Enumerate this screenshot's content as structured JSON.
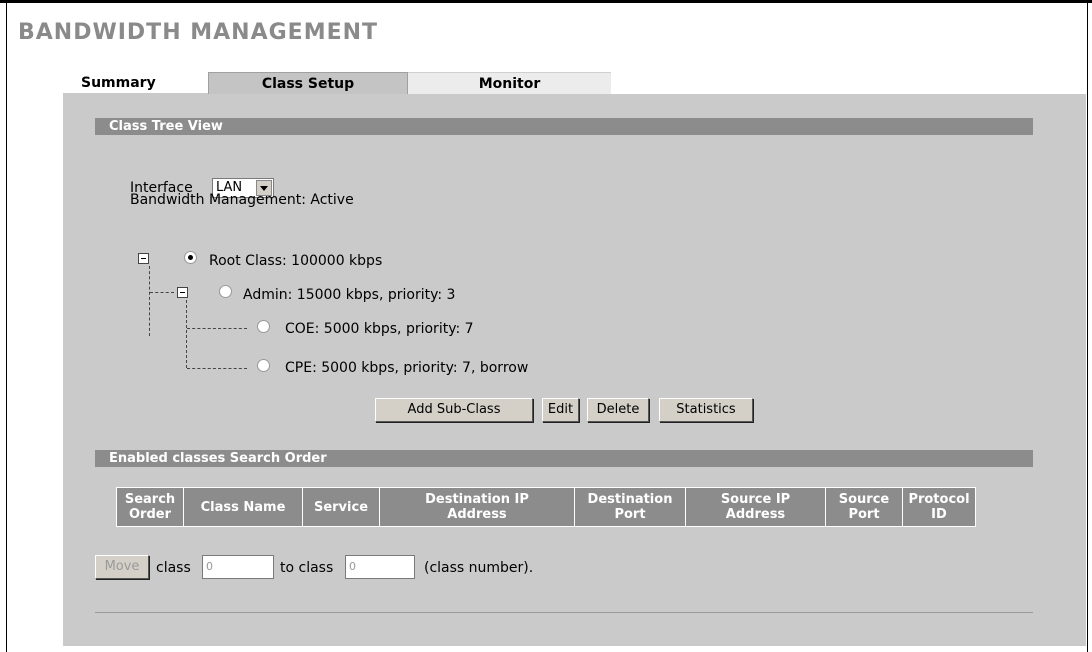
{
  "page_title": "BANDWIDTH MANAGEMENT",
  "tabs": [
    {
      "label": "Summary"
    },
    {
      "label": "Class Setup"
    },
    {
      "label": "Monitor"
    }
  ],
  "class_tree": {
    "section_title": "Class Tree View",
    "interface_label": "Interface",
    "interface_value": "LAN",
    "status_text": "Bandwidth Management: Active",
    "nodes": [
      {
        "label": "Root Class: 100000 kbps"
      },
      {
        "label": "Admin: 15000 kbps, priority: 3"
      },
      {
        "label": "COE: 5000 kbps, priority: 7"
      },
      {
        "label": "CPE: 5000 kbps, priority: 7, borrow"
      }
    ],
    "buttons": {
      "add_sub_class": "Add Sub-Class",
      "edit": "Edit",
      "delete": "Delete",
      "statistics": "Statistics"
    }
  },
  "search_order": {
    "section_title": "Enabled classes Search Order",
    "columns": [
      [
        "Search",
        "Order"
      ],
      [
        "Class Name"
      ],
      [
        "Service"
      ],
      [
        "Destination IP",
        "Address"
      ],
      [
        "Destination",
        "Port"
      ],
      [
        "Source IP",
        "Address"
      ],
      [
        "Source",
        "Port"
      ],
      [
        "Protocol",
        "ID"
      ]
    ],
    "move_button": "Move",
    "class_label": "class",
    "from_value": "0",
    "to_label": "to class",
    "to_value": "0",
    "hint": "(class number)."
  }
}
